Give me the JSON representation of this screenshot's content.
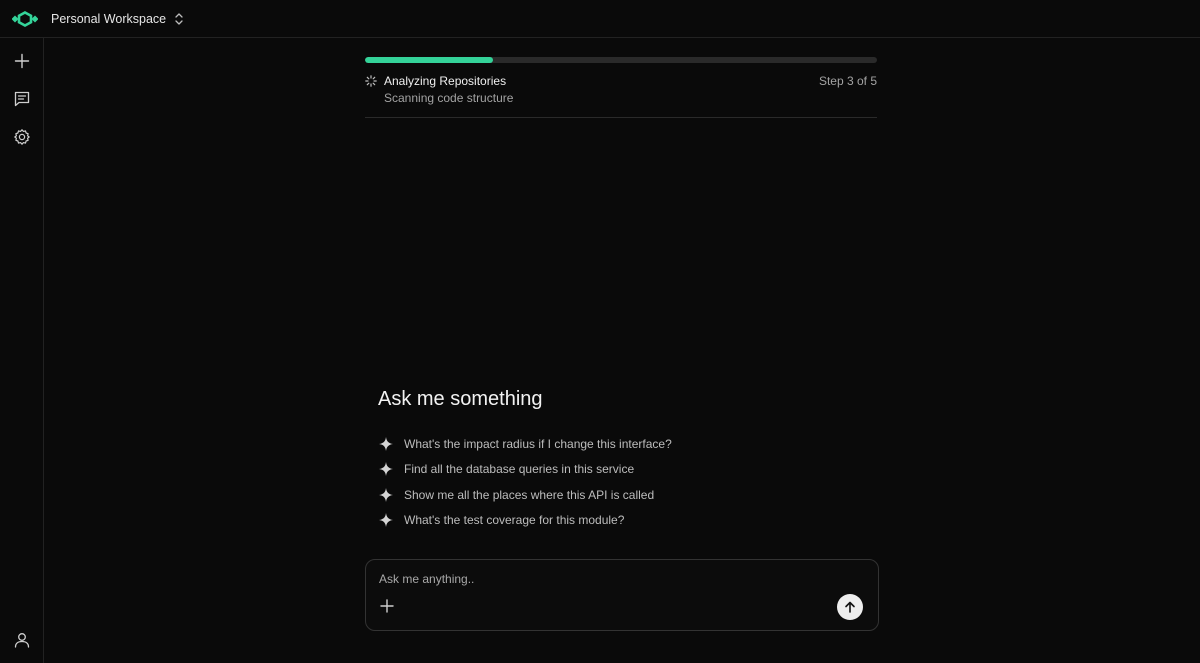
{
  "workspace": {
    "name": "Personal Workspace"
  },
  "colors": {
    "accent": "#34d399",
    "background": "#0a0a0a"
  },
  "sidebar": {
    "items": [
      {
        "icon": "plus-icon"
      },
      {
        "icon": "chat-icon"
      },
      {
        "icon": "gear-icon"
      }
    ],
    "footer_icon": "user-icon"
  },
  "progress": {
    "fraction": 0.25,
    "title": "Analyzing Repositories",
    "subtitle": "Scanning code structure",
    "step_text": "Step 3 of 5"
  },
  "ask": {
    "title": "Ask me something",
    "suggestions": [
      "What's the impact radius if I change this interface?",
      "Find all the database queries in this service",
      "Show me all the places where this API is called",
      "What's the test coverage for this module?"
    ]
  },
  "composer": {
    "placeholder": "Ask me anything..",
    "value": ""
  }
}
